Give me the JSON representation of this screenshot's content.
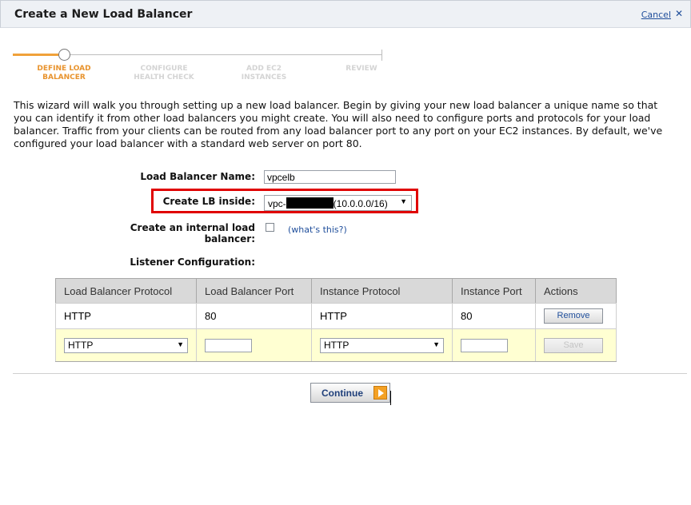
{
  "dialog": {
    "title": "Create a New Load Balancer",
    "cancel_label": "Cancel",
    "close_glyph": "✕"
  },
  "wizard": {
    "steps": [
      {
        "line1": "DEFINE LOAD",
        "line2": "BALANCER",
        "active": true
      },
      {
        "line1": "CONFIGURE",
        "line2": "HEALTH CHECK",
        "active": false
      },
      {
        "line1": "ADD EC2",
        "line2": "INSTANCES",
        "active": false
      },
      {
        "line1": "REVIEW",
        "line2": "",
        "active": false
      }
    ],
    "accent_color": "#e8932d"
  },
  "intro_text": "This wizard will walk you through setting up a new load balancer. Begin by giving your new load balancer a unique name so that you can identify it from other load balancers you might create. You will also need to configure ports and protocols for your load balancer. Traffic from your clients can be routed from any load balancer port to any port on your EC2 instances. By default, we've configured your load balancer with a standard web server on port 80.",
  "form": {
    "name_label": "Load Balancer Name:",
    "name_value": "vpcelb",
    "inside_label": "Create LB inside:",
    "vpc_prefix": "vpc-",
    "vpc_cidr": "(10.0.0.0/16)",
    "internal_label": "Create an internal load balancer:",
    "internal_checked": false,
    "help_link": "(what's this?)"
  },
  "listeners": {
    "section_label": "Listener Configuration:",
    "headers": [
      "Load Balancer Protocol",
      "Load Balancer Port",
      "Instance Protocol",
      "Instance Port",
      "Actions"
    ],
    "rows": [
      {
        "lb_protocol": "HTTP",
        "lb_port": "80",
        "instance_protocol": "HTTP",
        "instance_port": "80",
        "action": "Remove"
      }
    ],
    "new_row": {
      "lb_protocol": "HTTP",
      "lb_port": "",
      "instance_protocol": "HTTP",
      "instance_port": "",
      "action": "Save"
    }
  },
  "footer": {
    "continue_label": "Continue"
  },
  "colors": {
    "highlight": "#e00000",
    "link": "#1f4e9b",
    "new_row_bg": "#ffffd2"
  }
}
